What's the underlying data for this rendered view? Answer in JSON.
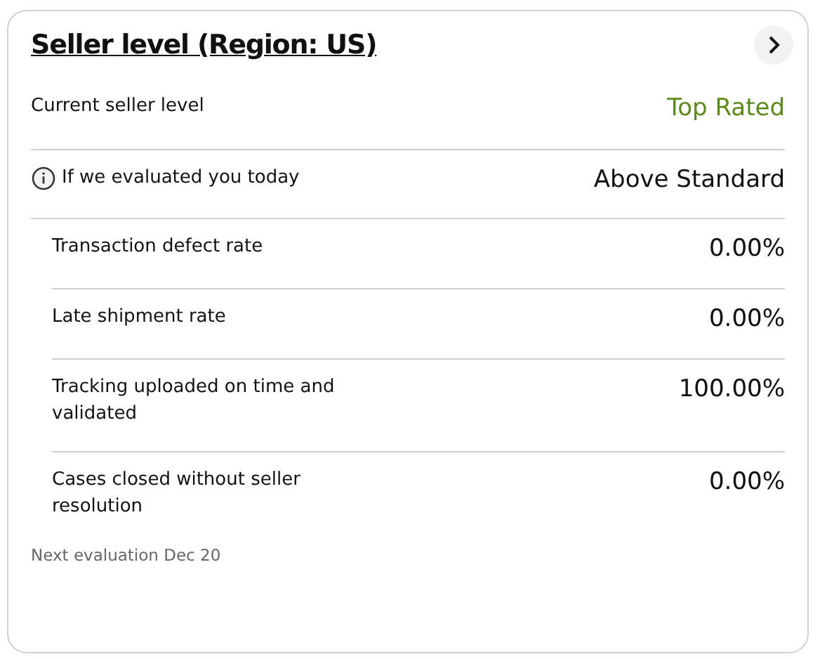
{
  "card": {
    "title": "Seller level (Region: US)",
    "current": {
      "label": "Current seller level",
      "value": "Top Rated"
    },
    "evaluation": {
      "label": "If we evaluated you today",
      "value": "Above Standard"
    },
    "metrics": [
      {
        "label": "Transaction defect rate",
        "value": "0.00%"
      },
      {
        "label": "Late shipment rate",
        "value": "0.00%"
      },
      {
        "label": "Tracking uploaded on time and validated",
        "value": "100.00%"
      },
      {
        "label": "Cases closed without seller resolution",
        "value": "0.00%"
      }
    ],
    "footer": "Next evaluation Dec 20"
  }
}
